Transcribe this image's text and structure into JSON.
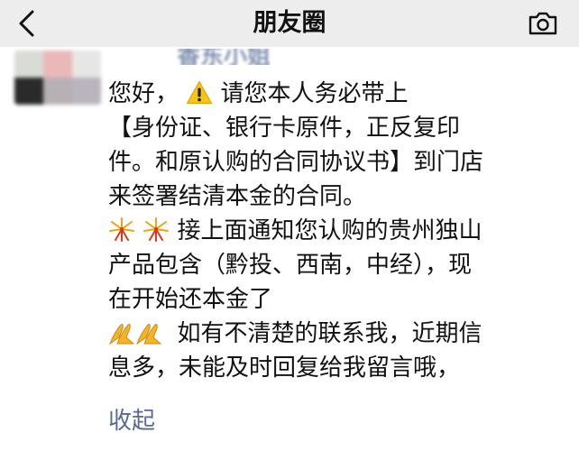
{
  "header": {
    "title": "朋友圈"
  },
  "post": {
    "author": "香东小姐",
    "lines": [
      "您好，",
      "请您本人务必带上",
      "【身份证、银行卡原件，正反复印",
      "件。和原认购的合同协议书】到门店",
      "来签署结清本金的合同。",
      "接上面通知您认购的贵州独山",
      "产品包含（黔投、西南，中经），现",
      "在开始还本金了",
      "如有不清楚的联系我，近期信",
      "息多，未能及时回复给我留言哦，"
    ],
    "collapse_label": "收起"
  },
  "icons": {
    "back": "back-chevron-icon",
    "camera": "camera-icon",
    "warning": "warning-icon",
    "fireworks": "fireworks-icon",
    "pray": "praying-hands-icon"
  },
  "colors": {
    "header_bg": "#ededed",
    "link": "#576b95",
    "warning": "#f5c518"
  }
}
